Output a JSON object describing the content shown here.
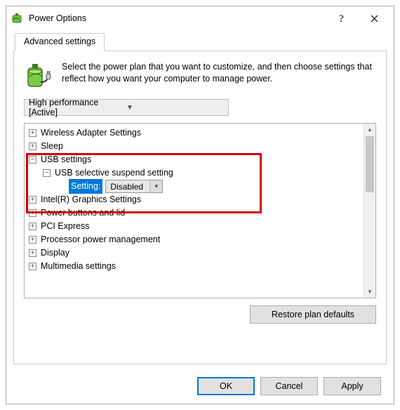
{
  "window": {
    "title": "Power Options"
  },
  "tab": {
    "label": "Advanced settings"
  },
  "intro": "Select the power plan that you want to customize, and then choose settings that reflect how you want your computer to manage power.",
  "plan": {
    "selected": "High performance [Active]"
  },
  "tree": {
    "items": [
      {
        "label": "Wireless Adapter Settings",
        "exp": "+",
        "depth": 1
      },
      {
        "label": "Sleep",
        "exp": "+",
        "depth": 1
      },
      {
        "label": "USB settings",
        "exp": "−",
        "depth": 1
      },
      {
        "label": "USB selective suspend setting",
        "exp": "−",
        "depth": 2
      },
      {
        "label": "Setting:",
        "exp": "",
        "depth": 3,
        "setting": true,
        "value": "Disabled"
      },
      {
        "label": "Intel(R) Graphics Settings",
        "exp": "+",
        "depth": 1
      },
      {
        "label": "Power buttons and lid",
        "exp": "+",
        "depth": 1
      },
      {
        "label": "PCI Express",
        "exp": "+",
        "depth": 1
      },
      {
        "label": "Processor power management",
        "exp": "+",
        "depth": 1
      },
      {
        "label": "Display",
        "exp": "+",
        "depth": 1
      },
      {
        "label": "Multimedia settings",
        "exp": "+",
        "depth": 1
      }
    ]
  },
  "buttons": {
    "restore": "Restore plan defaults",
    "ok": "OK",
    "cancel": "Cancel",
    "apply": "Apply"
  }
}
